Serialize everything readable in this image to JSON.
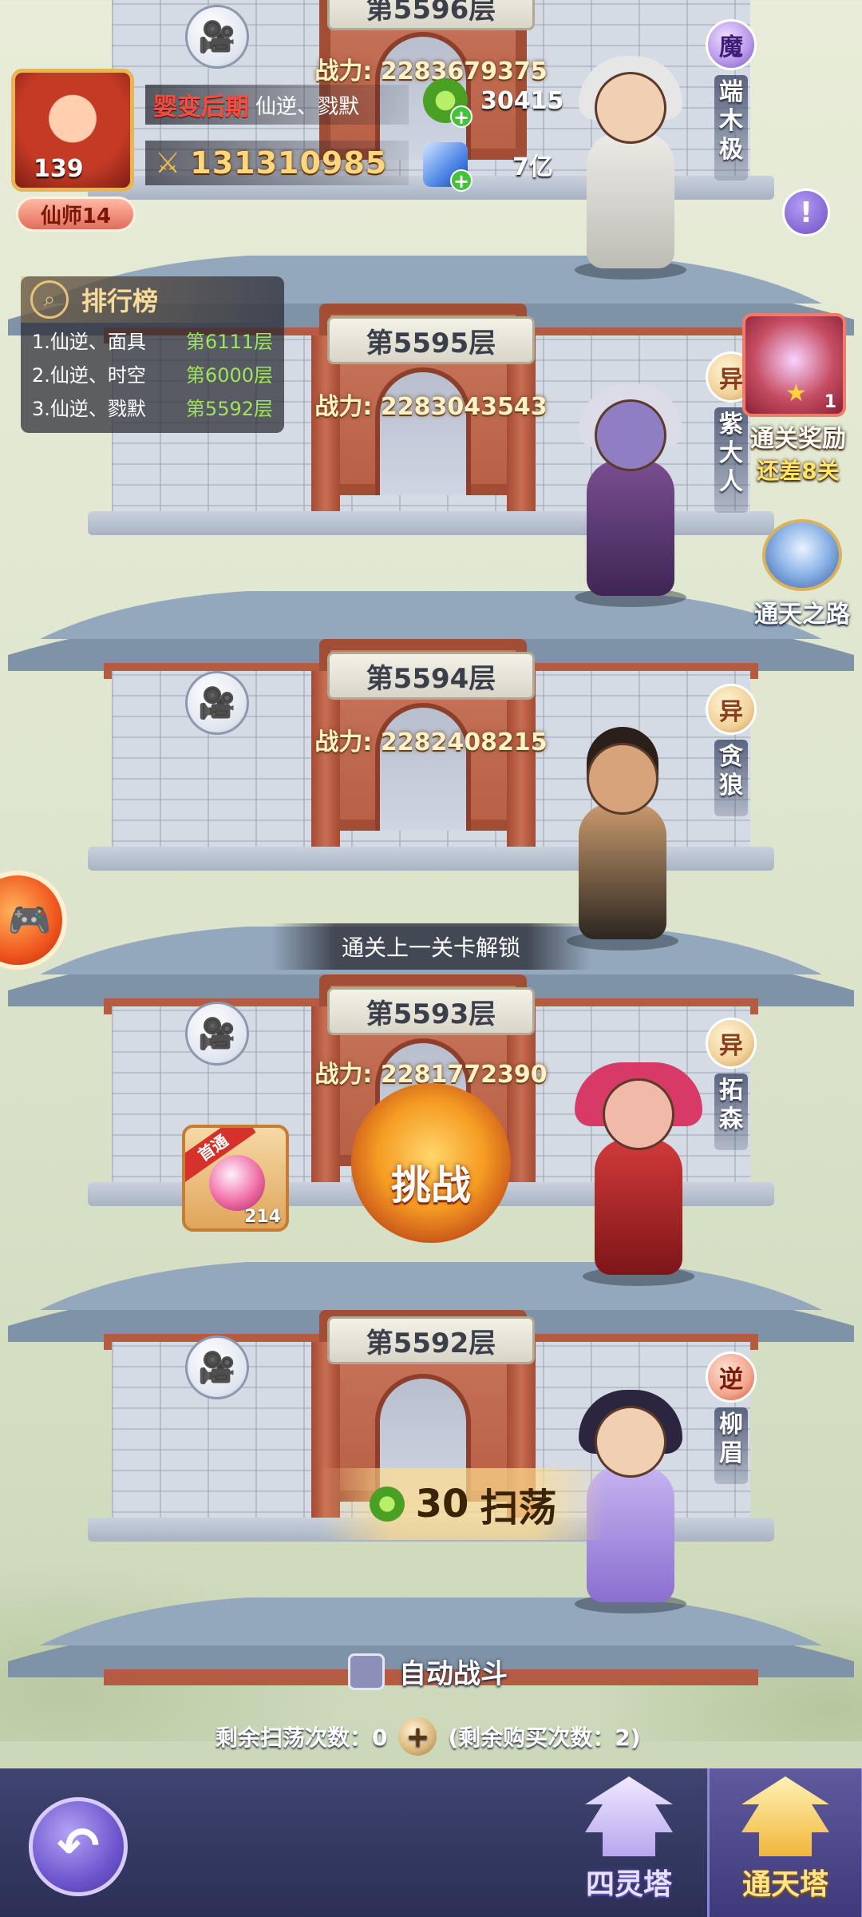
{
  "player": {
    "level": "139",
    "realm": "婴变后期",
    "name": "仙逆、戮默",
    "power": "131310985",
    "title_badge": "仙师14",
    "jade": "30415",
    "crystal": "7亿"
  },
  "ranking": {
    "title": "排行榜",
    "rows": [
      {
        "name": "1.仙逆、面具",
        "floor": "第6111层"
      },
      {
        "name": "2.仙逆、时空",
        "floor": "第6000层"
      },
      {
        "name": "3.仙逆、戮默",
        "floor": "第5592层"
      }
    ]
  },
  "floors": [
    {
      "label": "第5596层",
      "power": "战力: 2283679375",
      "boss_type": "魔",
      "boss_name": "端木极",
      "hair": "#e6e6e6",
      "robe": "#d9d9d2"
    },
    {
      "label": "第5595层",
      "power": "战力: 2283043543",
      "boss_type": "异",
      "boss_name": "紫大人",
      "hair": "#dcdce8",
      "robe": "#5a3b6e"
    },
    {
      "label": "第5594层",
      "power": "战力: 2282408215",
      "boss_type": "异",
      "boss_name": "贪狼",
      "hair": "#2b1f1a",
      "robe": "#6b4a2c"
    },
    {
      "label": "第5593层",
      "power": "战力: 2281772390",
      "boss_type": "异",
      "boss_name": "拓森",
      "hair": "#d83a67",
      "robe": "#b1202a"
    },
    {
      "label": "第5592层",
      "power": "",
      "boss_type": "逆",
      "boss_name": "柳眉",
      "hair": "#2c2540",
      "robe": "#a48be0"
    }
  ],
  "reward": {
    "title": "通关奖励",
    "subtitle": "还差8关",
    "qty": "1"
  },
  "path_label": "通天之路",
  "unlock_text": "通关上一关卡解锁",
  "fast_pass": {
    "ribbon": "首通",
    "count": "214"
  },
  "challenge_label": "挑战",
  "sweep": {
    "cost": "30",
    "label": "扫荡"
  },
  "auto_battle_label": "自动战斗",
  "sweep_info": {
    "remaining": "剩余扫荡次数：0",
    "buy": "(剩余购买次数：2)"
  },
  "nav": {
    "spirit_tower": "四灵塔",
    "sky_tower": "通天塔"
  }
}
